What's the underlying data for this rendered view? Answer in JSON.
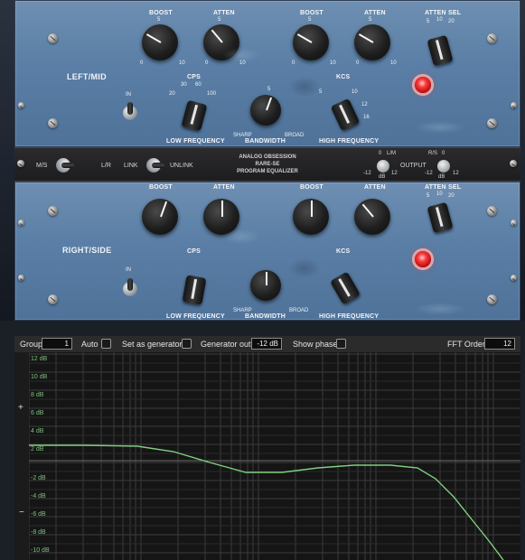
{
  "plugin": {
    "name_lines": [
      "ANALOG OBSESSION",
      "RARE-SE",
      "PROGRAM EQUALIZER"
    ],
    "top": {
      "section_label": "LEFT/MID",
      "knob_labels": {
        "boost_1": "BOOST",
        "atten_1": "ATTEN",
        "boost_2": "BOOST",
        "atten_2": "ATTEN",
        "atten_sel": "ATTEN SEL"
      },
      "scale": [
        "0",
        "1",
        "2",
        "3",
        "4",
        "5",
        "6",
        "7",
        "8",
        "9",
        "10"
      ],
      "atten_sel_values": [
        "5",
        "10",
        "20"
      ],
      "cps": {
        "label": "CPS",
        "values": [
          "20",
          "30",
          "60",
          "100"
        ]
      },
      "kcs": {
        "label": "KCS",
        "values": [
          "3",
          "4",
          "5",
          "8",
          "10",
          "12",
          "16"
        ]
      },
      "in_label": "IN",
      "bandwidth": "BANDWIDTH",
      "sharp": "SHARP",
      "broad": "BROAD",
      "low_frequency": "LOW FREQUENCY",
      "high_frequency": "HIGH FREQUENCY"
    },
    "strip": {
      "ms": "M/S",
      "lr": "L/R",
      "link": "LINK",
      "unlink": "UNLINK",
      "lm": "L/M",
      "rs": "R/S",
      "output": "OUTPUT",
      "zero": "0",
      "minus12": "-12",
      "plus12": "12",
      "db": "dB"
    },
    "bottom": {
      "section_label": "RIGHT/SIDE"
    },
    "lamp_color": "#ff3a3a",
    "panel_color": "#5a7ea5"
  },
  "analyzer": {
    "toolbar": {
      "group_label": "Group",
      "group_value": "1",
      "auto_label": "Auto",
      "set_generator_label": "Set as generator",
      "generator_out_label": "Generator out",
      "generator_out_value": "-12 dB",
      "show_phase_label": "Show phase",
      "fft_order_label": "FFT Order",
      "fft_order_value": "12"
    },
    "side_plus": "+",
    "side_minus": "−",
    "curve_color": "#7fd07f",
    "db_labels": [
      "12 dB",
      "10 dB",
      "8 dB",
      "6 dB",
      "4 dB",
      "2 dB",
      "-2 dB",
      "-4 dB",
      "-6 dB",
      "-8 dB",
      "-10 dB"
    ]
  }
}
